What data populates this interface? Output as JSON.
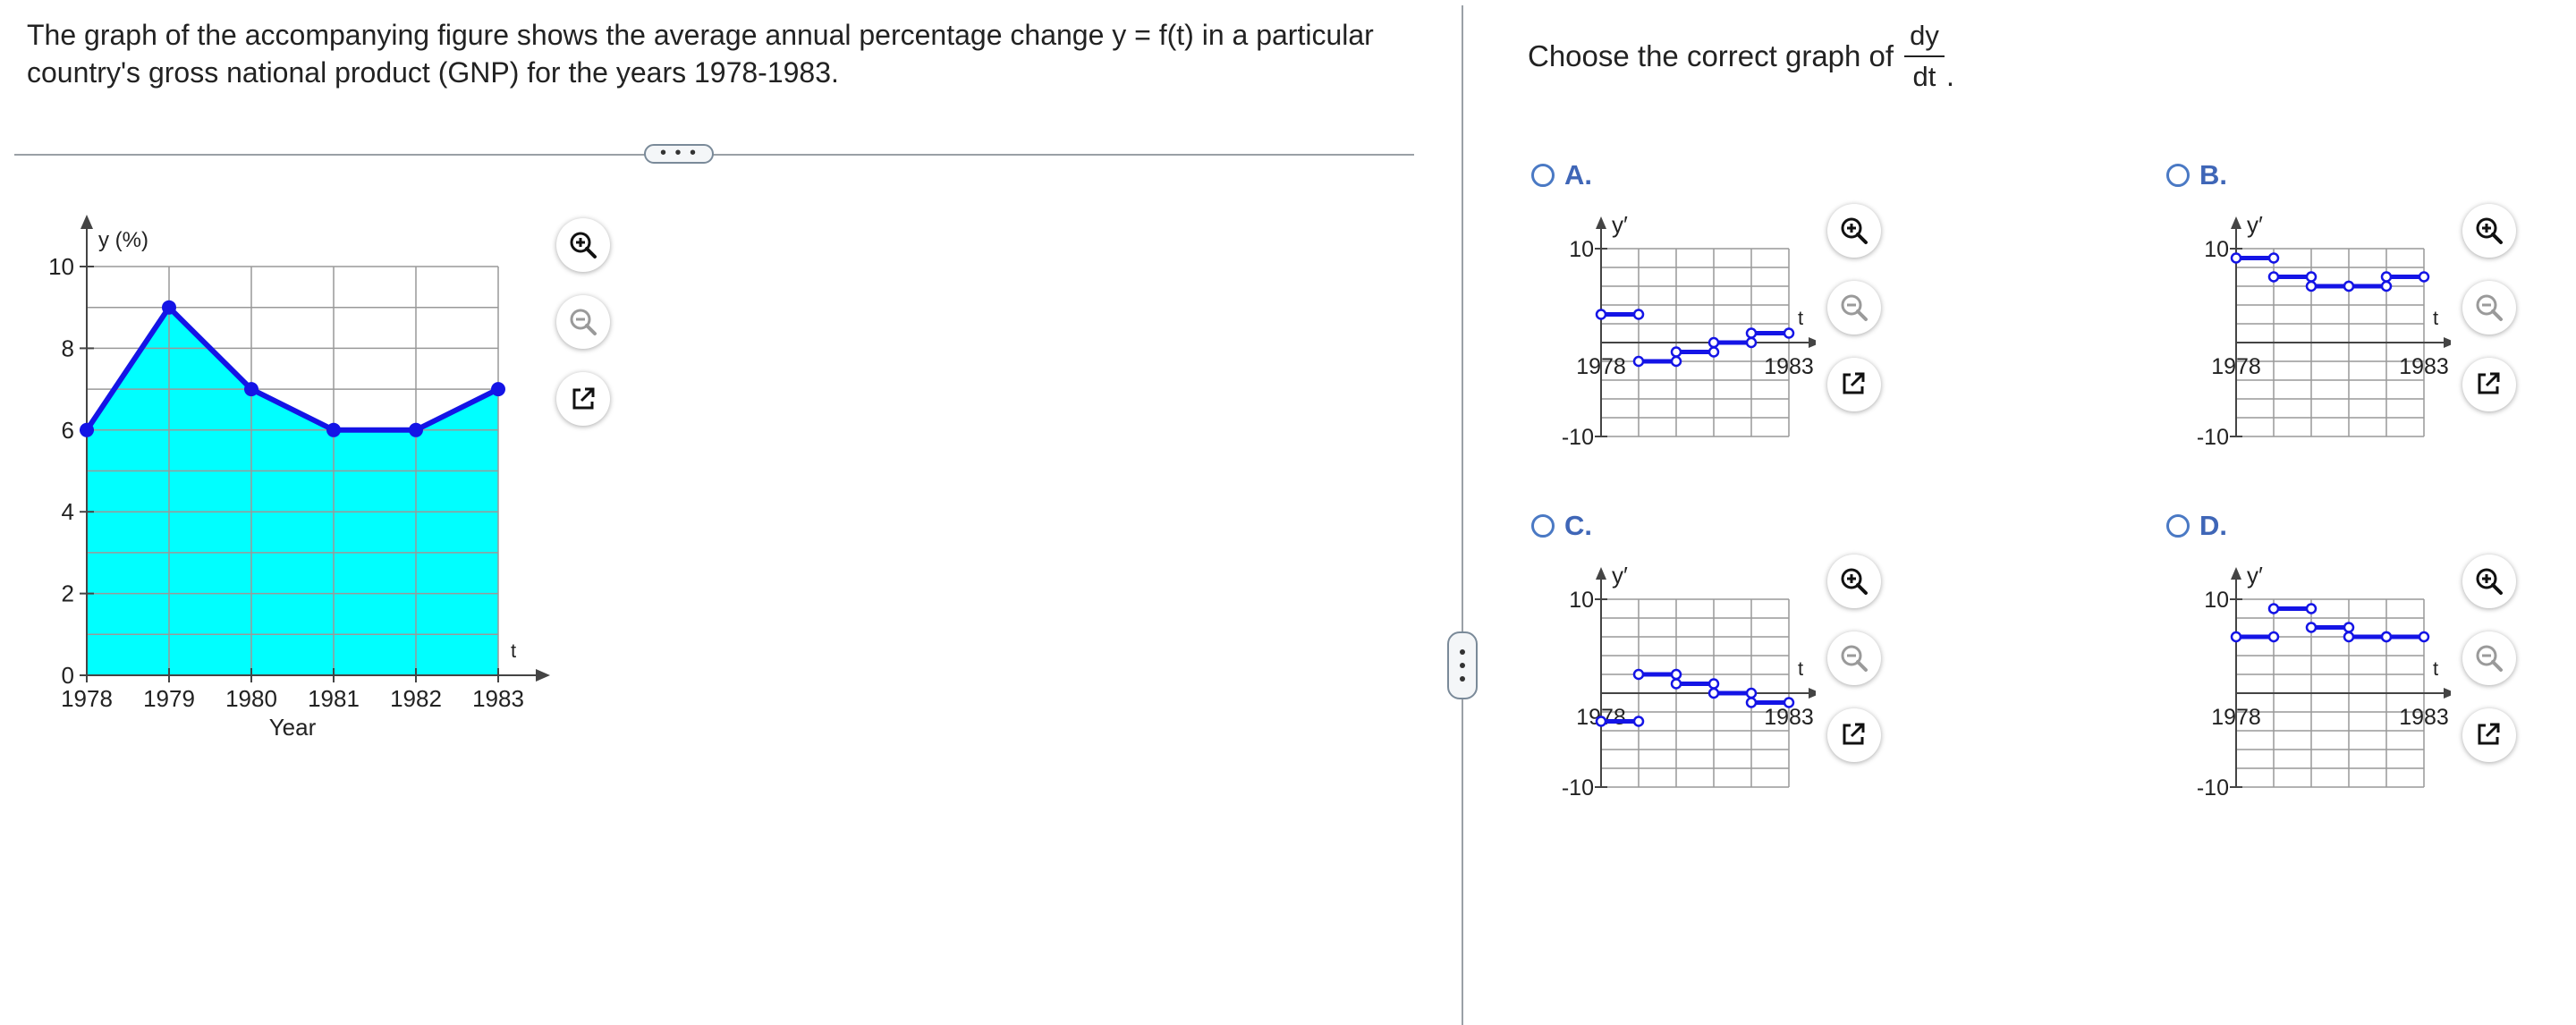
{
  "question": {
    "text": "The graph of the accompanying figure shows the average annual percentage change y = f(t) in a particular country's gross national product (GNP) for the years 1978-1983."
  },
  "more_button": {
    "label": "• • •"
  },
  "prompt": {
    "text": "Choose the correct graph of",
    "frac_num": "dy",
    "frac_den": "dt",
    "period": "."
  },
  "chart_data": [
    {
      "type": "area",
      "title": "",
      "xlabel": "Year",
      "ylabel": "y (%)",
      "x_axis_var": "t",
      "x": [
        1978,
        1979,
        1980,
        1981,
        1982,
        1983
      ],
      "series": [
        {
          "values": [
            6,
            9,
            7,
            6,
            6,
            7
          ]
        }
      ],
      "x_ticks": [
        "1978",
        "1979",
        "1980",
        "1981",
        "1982",
        "1983"
      ],
      "y_ticks": [
        "0",
        "2",
        "4",
        "6",
        "8",
        "10"
      ],
      "xlim": [
        1978,
        1983
      ],
      "ylim": [
        0,
        10
      ],
      "grid": true,
      "fill_color": "#00ffff",
      "line_color": "#1414e6"
    },
    {
      "type": "line",
      "option": "A",
      "ylabel": "y′",
      "x_axis_var": "t",
      "y_ticks": [
        "10",
        "-10"
      ],
      "x_ticks": [
        "1978",
        "1983"
      ],
      "ylim": [
        -10,
        10
      ],
      "xlim": [
        1978,
        1983
      ],
      "segments": [
        {
          "x": [
            1978,
            1979
          ],
          "y": 3
        },
        {
          "x": [
            1979,
            1980
          ],
          "y": -2
        },
        {
          "x": [
            1980,
            1981
          ],
          "y": -1
        },
        {
          "x": [
            1981,
            1982
          ],
          "y": 0
        },
        {
          "x": [
            1982,
            1983
          ],
          "y": 1
        }
      ]
    },
    {
      "type": "line",
      "option": "B",
      "ylabel": "y′",
      "x_axis_var": "t",
      "y_ticks": [
        "10",
        "-10"
      ],
      "x_ticks": [
        "1978",
        "1983"
      ],
      "ylim": [
        -10,
        10
      ],
      "xlim": [
        1978,
        1983
      ],
      "segments": [
        {
          "x": [
            1978,
            1979
          ],
          "y": 9
        },
        {
          "x": [
            1979,
            1980
          ],
          "y": 7
        },
        {
          "x": [
            1980,
            1981
          ],
          "y": 6
        },
        {
          "x": [
            1981,
            1982
          ],
          "y": 6
        },
        {
          "x": [
            1982,
            1983
          ],
          "y": 7
        }
      ]
    },
    {
      "type": "line",
      "option": "C",
      "ylabel": "y′",
      "x_axis_var": "t",
      "y_ticks": [
        "10",
        "-10"
      ],
      "x_ticks": [
        "1978",
        "1983"
      ],
      "ylim": [
        -10,
        10
      ],
      "xlim": [
        1978,
        1983
      ],
      "segments": [
        {
          "x": [
            1978,
            1979
          ],
          "y": -3
        },
        {
          "x": [
            1979,
            1980
          ],
          "y": 2
        },
        {
          "x": [
            1980,
            1981
          ],
          "y": 1
        },
        {
          "x": [
            1981,
            1982
          ],
          "y": 0
        },
        {
          "x": [
            1982,
            1983
          ],
          "y": -1
        }
      ]
    },
    {
      "type": "line",
      "option": "D",
      "ylabel": "y′",
      "x_axis_var": "t",
      "y_ticks": [
        "10",
        "-10"
      ],
      "x_ticks": [
        "1978",
        "1983"
      ],
      "ylim": [
        -10,
        10
      ],
      "xlim": [
        1978,
        1983
      ],
      "segments": [
        {
          "x": [
            1978,
            1979
          ],
          "y": 6
        },
        {
          "x": [
            1979,
            1980
          ],
          "y": 9
        },
        {
          "x": [
            1980,
            1981
          ],
          "y": 7
        },
        {
          "x": [
            1981,
            1982
          ],
          "y": 6
        },
        {
          "x": [
            1982,
            1983
          ],
          "y": 6
        }
      ]
    }
  ],
  "options": [
    {
      "letter": "A."
    },
    {
      "letter": "B."
    },
    {
      "letter": "C."
    },
    {
      "letter": "D."
    }
  ],
  "icons": {
    "zoom_in": "zoom-in-icon",
    "zoom_out": "zoom-out-icon",
    "popout": "popout-icon"
  },
  "colors": {
    "series_blue": "#1414e6",
    "fill_cyan": "#00ffff",
    "option_blue": "#3f66b7",
    "grid": "#9a9a9a"
  }
}
